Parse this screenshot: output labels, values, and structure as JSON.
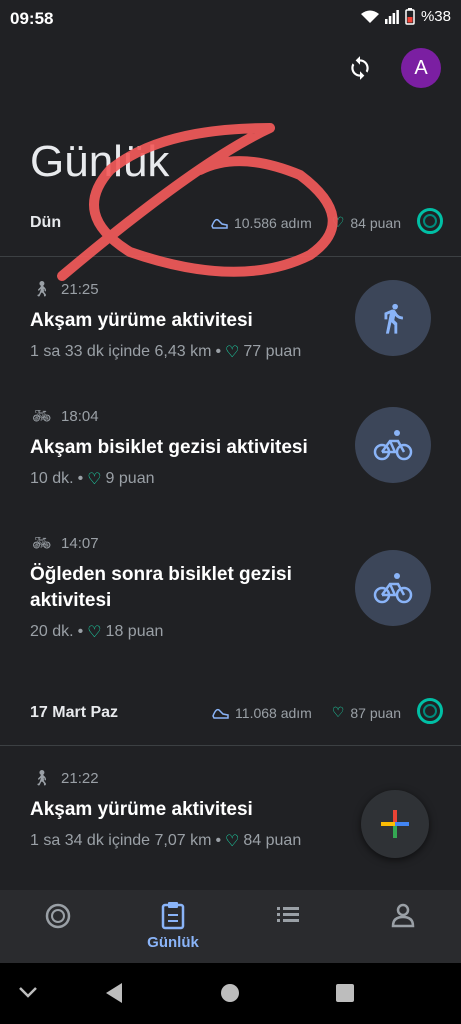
{
  "status": {
    "time": "09:58",
    "battery": "%38"
  },
  "header": {
    "avatar_letter": "A",
    "title": "Günlük"
  },
  "days": [
    {
      "label": "Dün",
      "steps": "10.586 adım",
      "points": "84 puan"
    },
    {
      "label": "17 Mart Paz",
      "steps": "11.068 adım",
      "points": "87 puan"
    }
  ],
  "activities": [
    {
      "time": "21:25",
      "title": "Akşam yürüme aktivitesi",
      "meta": "1 sa 33 dk içinde 6,43 km",
      "points": "77 puan",
      "kind": "walk"
    },
    {
      "time": "18:04",
      "title": "Akşam bisiklet gezisi aktivitesi",
      "meta": "10 dk.",
      "points": "9 puan",
      "kind": "bike"
    },
    {
      "time": "14:07",
      "title": "Öğleden sonra bisiklet gezisi aktivitesi",
      "meta": "20 dk.",
      "points": "18 puan",
      "kind": "bike"
    },
    {
      "time": "21:22",
      "title": "Akşam yürüme aktivitesi",
      "meta": "1 sa 34 dk içinde 7,07 km",
      "points": "84 puan",
      "kind": "walk"
    }
  ],
  "nav": {
    "journal": "Günlük"
  },
  "colors": {
    "accent": "#8ab4f8",
    "heart": "#1de9b6",
    "annotation": "#f25a5a",
    "avatar": "#7b1fa2"
  }
}
